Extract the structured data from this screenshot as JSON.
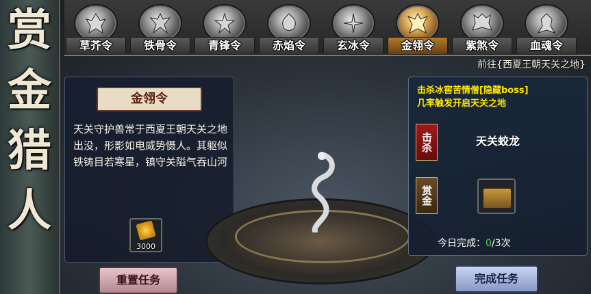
{
  "title_chars": [
    "赏",
    "金",
    "猎",
    "人"
  ],
  "tabs": [
    {
      "label": "草芥令"
    },
    {
      "label": "铁骨令"
    },
    {
      "label": "青锋令"
    },
    {
      "label": "赤焰令"
    },
    {
      "label": "玄冰令"
    },
    {
      "label": "金翎令"
    },
    {
      "label": "紫煞令"
    },
    {
      "label": "血魂令"
    }
  ],
  "active_tab": "金翎令",
  "destination": "前往{西夏王朝天关之地}",
  "left_panel": {
    "token_name": "金翎令",
    "description": "天关守护兽常于西夏王朝天关之地出没，形影如电威势慑人。其躯似铁铸目若寒星，镇守关隘气吞山河",
    "reward_qty": "3000"
  },
  "right_panel": {
    "trigger_line1": "击杀冰窖苦情僧[隐藏boss]",
    "trigger_line2": "几率触发开启天关之地",
    "kill_tag": "击杀",
    "target": "天关蛟龙",
    "reward_tag": "赏金",
    "progress_label": "今日完成：",
    "progress_done": "0",
    "progress_total": "/3次"
  },
  "buttons": {
    "reset": "重置任务",
    "complete": "完成任务"
  },
  "colors": {
    "trigger_text": "#ffe600",
    "progress_done": "#44e044"
  }
}
